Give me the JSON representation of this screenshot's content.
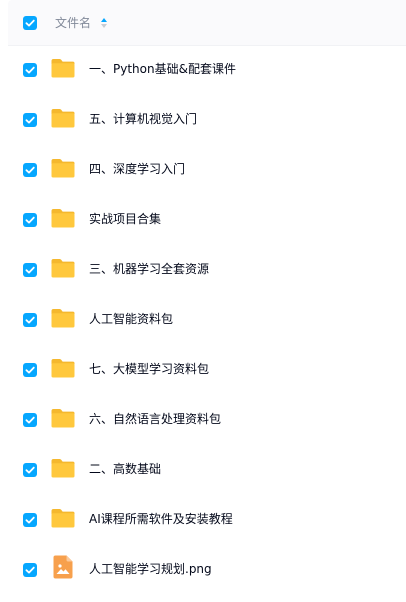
{
  "header": {
    "name_column_label": "文件名",
    "select_all_checked": true,
    "sort_icon": "sort-ascending-icon"
  },
  "files": [
    {
      "name": "一、Python基础&配套课件",
      "type": "folder",
      "icon": "folder-icon",
      "checked": true
    },
    {
      "name": "五、计算机视觉入门",
      "type": "folder",
      "icon": "folder-icon",
      "checked": true
    },
    {
      "name": "四、深度学习入门",
      "type": "folder",
      "icon": "folder-icon",
      "checked": true
    },
    {
      "name": "实战项目合集",
      "type": "folder",
      "icon": "folder-icon",
      "checked": true
    },
    {
      "name": "三、机器学习全套资源",
      "type": "folder",
      "icon": "folder-icon",
      "checked": true
    },
    {
      "name": "人工智能资料包",
      "type": "folder",
      "icon": "folder-icon",
      "checked": true
    },
    {
      "name": "七、大模型学习资料包",
      "type": "folder",
      "icon": "folder-icon",
      "checked": true
    },
    {
      "name": "六、自然语言处理资料包",
      "type": "folder",
      "icon": "folder-icon",
      "checked": true
    },
    {
      "name": "二、高数基础",
      "type": "folder",
      "icon": "folder-icon",
      "checked": true
    },
    {
      "name": "AI课程所需软件及安装教程",
      "type": "folder",
      "icon": "folder-icon",
      "checked": true
    },
    {
      "name": "人工智能学习规划.png",
      "type": "image",
      "icon": "image-file-icon",
      "checked": true
    }
  ],
  "colors": {
    "accent": "#06a7ff",
    "folder": "#ffc83d",
    "image_file": "#f7a04d",
    "text": "#03081a",
    "muted_text": "#818999"
  }
}
